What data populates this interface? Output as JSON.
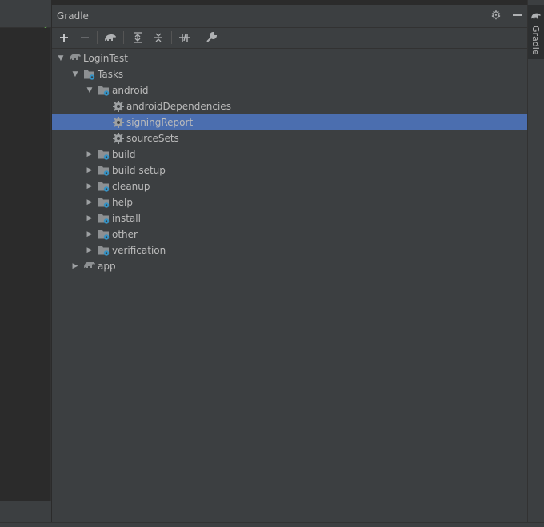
{
  "panel": {
    "title": "Gradle",
    "settings_icon": "gear-icon",
    "minimize_icon": "minimize-icon"
  },
  "toolbar": {
    "buttons": [
      {
        "name": "add-button",
        "icon": "plus-icon"
      },
      {
        "name": "remove-button",
        "icon": "minus-icon"
      },
      {
        "name": "execute-task-button",
        "icon": "elephant-icon"
      },
      {
        "name": "expand-all-button",
        "icon": "expand-all-icon"
      },
      {
        "name": "collapse-all-button",
        "icon": "collapse-all-icon"
      },
      {
        "name": "toggle-offline-button",
        "icon": "offline-icon"
      },
      {
        "name": "build-settings-button",
        "icon": "wrench-icon"
      }
    ]
  },
  "tree": [
    {
      "label": "LoginTest",
      "level": 0,
      "expanded": true,
      "icon": "elephant-icon"
    },
    {
      "label": "Tasks",
      "level": 1,
      "expanded": true,
      "icon": "folder-gear-icon"
    },
    {
      "label": "android",
      "level": 2,
      "expanded": true,
      "icon": "folder-gear-icon"
    },
    {
      "label": "androidDependencies",
      "level": 3,
      "icon": "gear-icon"
    },
    {
      "label": "signingReport",
      "level": 3,
      "icon": "gear-icon",
      "selected": true
    },
    {
      "label": "sourceSets",
      "level": 3,
      "icon": "gear-icon"
    },
    {
      "label": "build",
      "level": 2,
      "expanded": false,
      "icon": "folder-gear-icon"
    },
    {
      "label": "build setup",
      "level": 2,
      "expanded": false,
      "icon": "folder-gear-icon"
    },
    {
      "label": "cleanup",
      "level": 2,
      "expanded": false,
      "icon": "folder-gear-icon"
    },
    {
      "label": "help",
      "level": 2,
      "expanded": false,
      "icon": "folder-gear-icon"
    },
    {
      "label": "install",
      "level": 2,
      "expanded": false,
      "icon": "folder-gear-icon"
    },
    {
      "label": "other",
      "level": 2,
      "expanded": false,
      "icon": "folder-gear-icon"
    },
    {
      "label": "verification",
      "level": 2,
      "expanded": false,
      "icon": "folder-gear-icon"
    },
    {
      "label": "app",
      "level": 1,
      "expanded": false,
      "icon": "elephant-icon"
    }
  ],
  "right_stripe": {
    "label": "Gradle",
    "icon": "elephant-icon"
  },
  "colors": {
    "panel_bg": "#3c3f41",
    "selection": "#4b6eaf",
    "text": "#bbbbbb",
    "accent_blue": "#3592c4"
  }
}
